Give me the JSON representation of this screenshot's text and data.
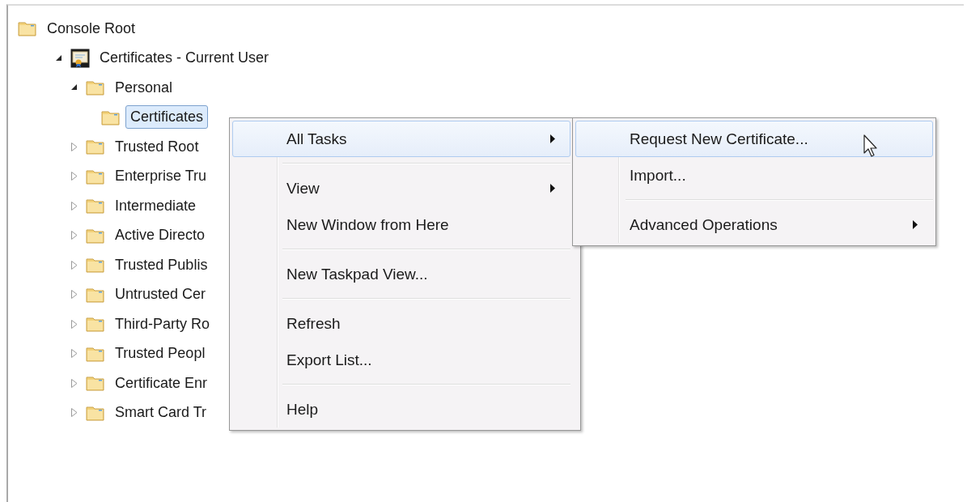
{
  "tree": [
    {
      "label": "Console Root",
      "kind": "folder",
      "selected": false,
      "children": [
        {
          "label": "Certificates - Current User",
          "kind": "snapin",
          "expanded": true,
          "selected": false,
          "children": [
            {
              "label": "Personal",
              "kind": "folder",
              "expanded": true,
              "selected": false,
              "children": [
                {
                  "label": "Certificates",
                  "kind": "folder",
                  "selected": true
                }
              ]
            },
            {
              "label": "Trusted Root",
              "kind": "folder",
              "expanded": false,
              "selected": false
            },
            {
              "label": "Enterprise Tru",
              "kind": "folder",
              "expanded": false,
              "selected": false
            },
            {
              "label": "Intermediate",
              "kind": "folder",
              "expanded": false,
              "selected": false
            },
            {
              "label": "Active Directo",
              "kind": "folder",
              "expanded": false,
              "selected": false
            },
            {
              "label": "Trusted Publis",
              "kind": "folder",
              "expanded": false,
              "selected": false
            },
            {
              "label": "Untrusted Cer",
              "kind": "folder",
              "expanded": false,
              "selected": false
            },
            {
              "label": "Third-Party Ro",
              "kind": "folder",
              "expanded": false,
              "selected": false
            },
            {
              "label": "Trusted Peopl",
              "kind": "folder",
              "expanded": false,
              "selected": false
            },
            {
              "label": "Certificate Enr",
              "kind": "folder",
              "expanded": false,
              "selected": false
            },
            {
              "label": "Smart Card Tr",
              "kind": "folder",
              "expanded": false,
              "selected": false
            }
          ]
        }
      ]
    }
  ],
  "context_menu": {
    "groups": [
      [
        {
          "label": "All Tasks",
          "submenu": true,
          "selected": true
        }
      ],
      [
        {
          "label": "View",
          "submenu": true,
          "selected": false
        },
        {
          "label": "New Window from Here",
          "submenu": false,
          "selected": false
        }
      ],
      [
        {
          "label": "New Taskpad View...",
          "submenu": false,
          "selected": false
        }
      ],
      [
        {
          "label": "Refresh",
          "submenu": false,
          "selected": false
        },
        {
          "label": "Export List...",
          "submenu": false,
          "selected": false
        }
      ],
      [
        {
          "label": "Help",
          "submenu": false,
          "selected": false
        }
      ]
    ]
  },
  "submenu": {
    "groups": [
      [
        {
          "label": "Request New Certificate...",
          "submenu": false,
          "selected": true
        },
        {
          "label": "Import...",
          "submenu": false,
          "selected": false
        }
      ],
      [
        {
          "label": "Advanced Operations",
          "submenu": true,
          "selected": false
        }
      ]
    ]
  }
}
